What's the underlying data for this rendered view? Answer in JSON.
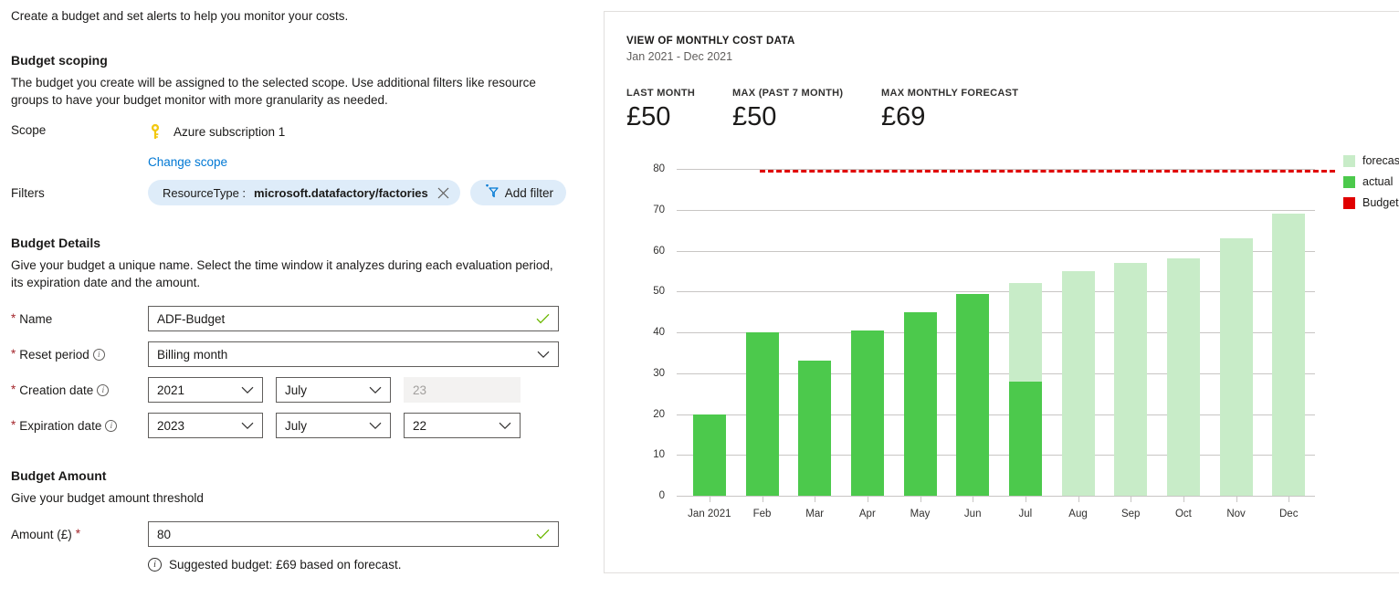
{
  "intro": "Create a budget and set alerts to help you monitor your costs.",
  "scoping": {
    "title": "Budget scoping",
    "description": "The budget you create will be assigned to the selected scope. Use additional filters like resource groups to have your budget monitor with more granularity as needed.",
    "scope_label": "Scope",
    "scope_icon": "key-icon",
    "scope_value": "Azure subscription 1",
    "change_scope_link": "Change scope",
    "filters_label": "Filters",
    "filter_pill_key": "ResourceType :",
    "filter_pill_value": "microsoft.datafactory/factories",
    "add_filter_label": "Add filter"
  },
  "details": {
    "title": "Budget Details",
    "description": "Give your budget a unique name. Select the time window it analyzes during each evaluation period, its expiration date and the amount.",
    "name_label": "Name",
    "name_value": "ADF-Budget",
    "reset_label": "Reset period",
    "reset_value": "Billing month",
    "creation_label": "Creation date",
    "creation_year": "2021",
    "creation_month": "July",
    "creation_day": "23",
    "expiration_label": "Expiration date",
    "expiration_year": "2023",
    "expiration_month": "July",
    "expiration_day": "22"
  },
  "amount": {
    "title": "Budget Amount",
    "description": "Give your budget amount threshold",
    "field_label": "Amount (£)",
    "value": "80",
    "suggestion": "Suggested budget: £69 based on forecast."
  },
  "panel": {
    "title": "VIEW OF MONTHLY COST DATA",
    "subtitle": "Jan 2021 - Dec 2021",
    "kpis": [
      {
        "label": "LAST MONTH",
        "value": "£50"
      },
      {
        "label": "MAX (PAST 7 MONTH)",
        "value": "£50"
      },
      {
        "label": "MAX MONTHLY FORECAST",
        "value": "£69"
      }
    ]
  },
  "colors": {
    "actual": "#4cc94c",
    "forecast": "#c8ecc8",
    "budget": "#e00000",
    "link": "#0078d4",
    "required": "#a4262c",
    "pill_bg": "#deecf9"
  },
  "chart_data": {
    "type": "bar",
    "title": "View of monthly cost data",
    "subtitle": "Jan 2021 - Dec 2021",
    "xlabel": "",
    "ylabel": "",
    "ylim": [
      0,
      80
    ],
    "yticks": [
      0,
      10,
      20,
      30,
      40,
      50,
      60,
      70,
      80
    ],
    "grid": true,
    "legend_position": "right",
    "categories": [
      "Jan 2021",
      "Feb",
      "Mar",
      "Apr",
      "May",
      "Jun",
      "Jul",
      "Aug",
      "Sep",
      "Oct",
      "Nov",
      "Dec"
    ],
    "series": [
      {
        "name": "actual",
        "color": "#4cc94c",
        "values": [
          20,
          40,
          33,
          40.5,
          45,
          49.5,
          28,
          null,
          null,
          null,
          null,
          null
        ]
      },
      {
        "name": "forecast",
        "color": "#c8ecc8",
        "values": [
          null,
          null,
          null,
          null,
          null,
          null,
          52,
          55,
          57,
          58,
          63,
          69
        ]
      }
    ],
    "annotations": [
      {
        "name": "Budget",
        "type": "hline",
        "value": 80,
        "color": "#e00000",
        "style": "dashed"
      }
    ],
    "legend": [
      {
        "label": "forecast",
        "color": "#c8ecc8"
      },
      {
        "label": "actual",
        "color": "#4cc94c"
      },
      {
        "label": "Budget",
        "color": "#e00000"
      }
    ]
  }
}
